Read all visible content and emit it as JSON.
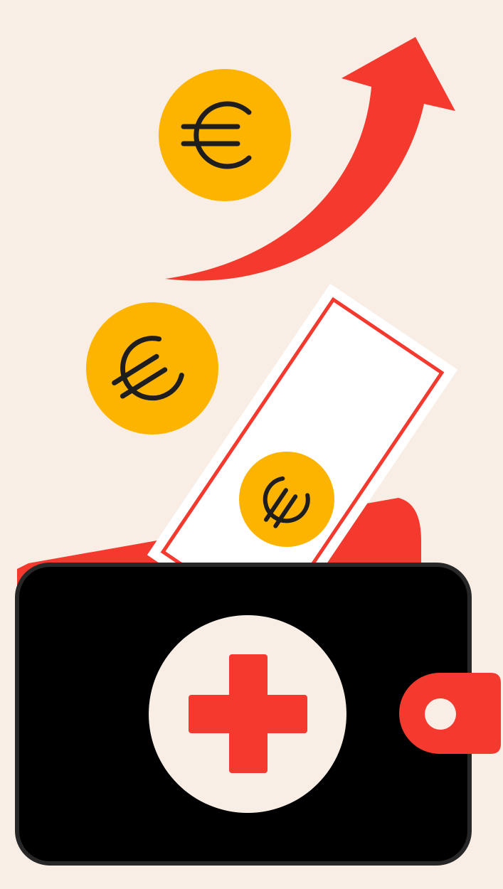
{
  "illustration": {
    "subject": "wallet-with-medical-cross-and-rising-euro-coins",
    "icons": [
      "euro-coin-icon",
      "euro-coin-icon",
      "euro-coin-icon",
      "arrow-up-icon",
      "banknote-icon",
      "wallet-icon",
      "medical-cross-icon"
    ],
    "colors": {
      "background": "#F8EEE5",
      "coin": "#FDB400",
      "coin_symbol": "#1E1E1E",
      "accent_red": "#F43A2F",
      "wallet_body": "#000000",
      "wallet_outline": "#272727",
      "banknote": "#FFFFFF",
      "cross_circle": "#F8EEE5"
    }
  }
}
